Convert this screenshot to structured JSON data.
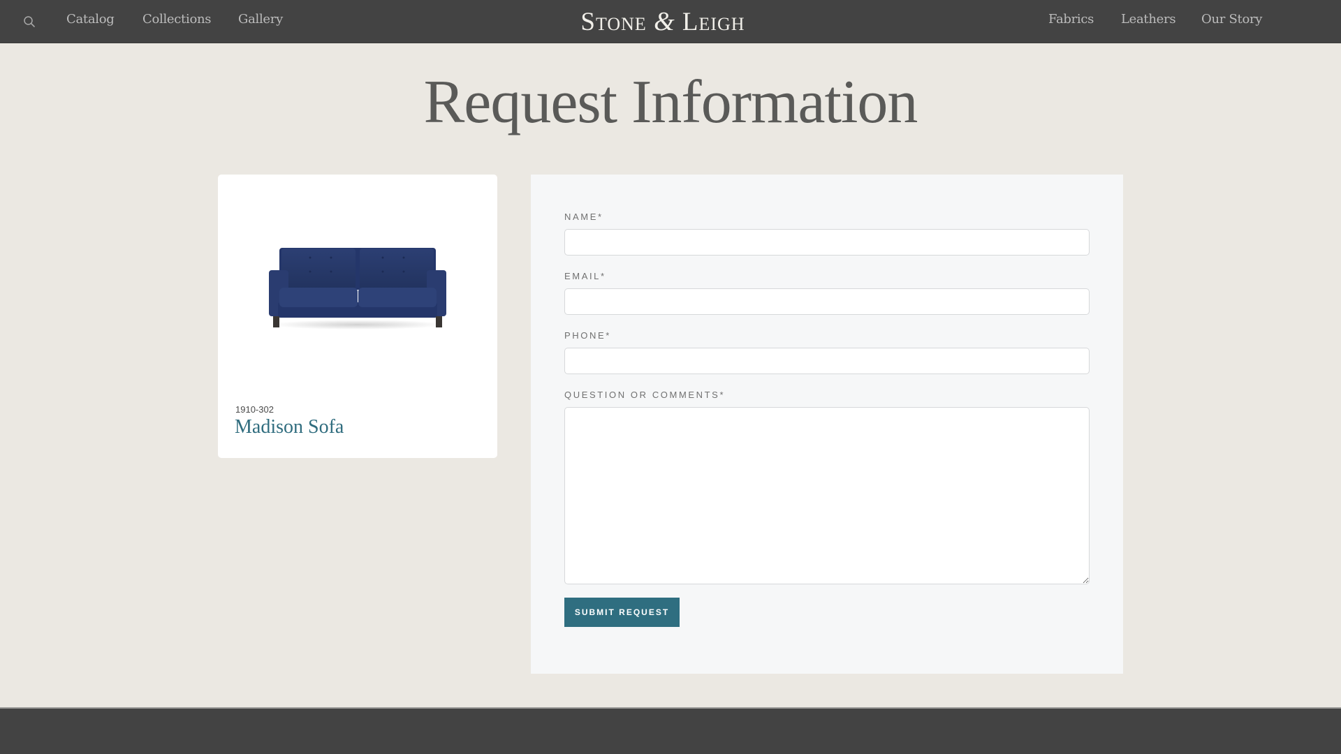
{
  "nav": {
    "search_icon": "search-icon",
    "left_links": [
      "Catalog",
      "Collections",
      "Gallery"
    ],
    "logo": {
      "part1": "Stone",
      "amp": "&",
      "part2": "Leigh"
    },
    "right_links": [
      "Fabrics",
      "Leathers",
      "Our Story"
    ]
  },
  "page": {
    "title": "Request Information"
  },
  "product": {
    "image": "sofa-image",
    "sku": "1910-302",
    "name": "Madison Sofa"
  },
  "form": {
    "fields": [
      {
        "label": "Name*",
        "value": "",
        "placeholder": ""
      },
      {
        "label": "Email*",
        "value": "",
        "placeholder": ""
      },
      {
        "label": "Phone*",
        "value": "",
        "placeholder": ""
      },
      {
        "label": "Question or Comments*",
        "value": "",
        "placeholder": ""
      }
    ],
    "submit_label": "Submit Request"
  },
  "colors": {
    "nav_bg": "#434343",
    "page_bg": "#ebe8e2",
    "accent": "#2f6e80",
    "product_name": "#2f6c7e",
    "panel_bg": "#f6f7f8"
  }
}
